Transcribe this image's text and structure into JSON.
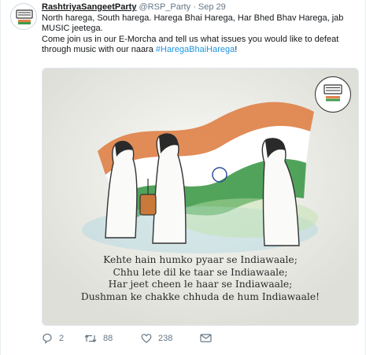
{
  "tweet": {
    "author_name": "RashtriyaSangeetParty",
    "handle": "@RSP_Party",
    "separator": "·",
    "timestamp": "Sep 29",
    "line1": "North harega, South harega. Harega Bhai Harega, Har Bhed Bhav Harega, jab MUSIC jeetega.",
    "line2_prefix": "Come join us in our E-Morcha and tell us what issues you would like to defeat through music with our naara ",
    "hashtag": "#HaregaBhaiHarega",
    "line2_suffix": "!"
  },
  "media": {
    "poem": [
      "Kehte hain humko pyaar se Indiawaale;",
      "Chhu lete dil ke taar se Indiawaale;",
      "Har jeet cheen le haar se Indiawaale;",
      "Dushman ke chakke chhuda de hum Indiawaale!"
    ],
    "flag_colors": {
      "saffron": "#e0824a",
      "white": "#ffffff",
      "green": "#3f9a4a"
    }
  },
  "actions": {
    "reply_count": "2",
    "retweet_count": "88",
    "like_count": "238"
  },
  "icons": [
    "reply-icon",
    "retweet-icon",
    "like-icon",
    "message-icon",
    "party-logo-icon"
  ]
}
